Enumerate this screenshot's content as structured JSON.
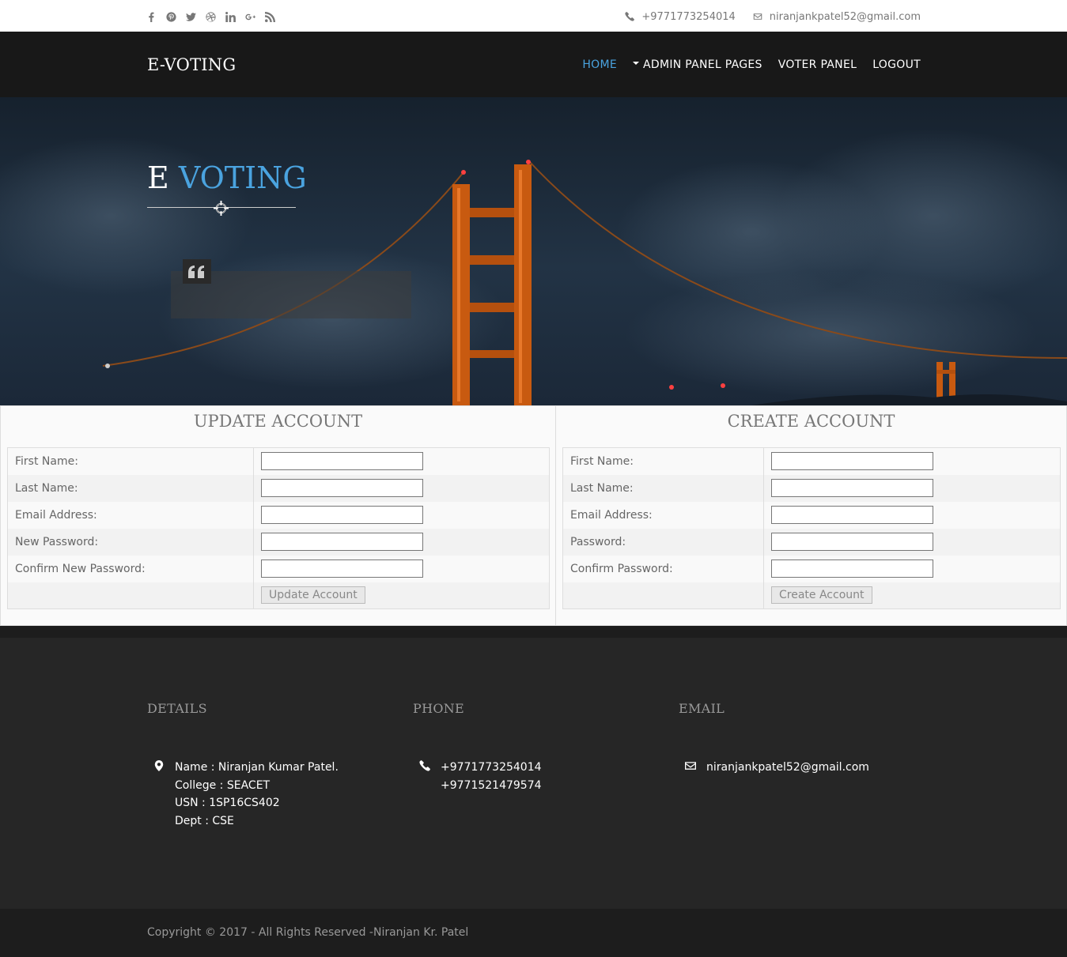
{
  "topbar": {
    "social_icons": [
      "facebook-icon",
      "pinterest-icon",
      "twitter-icon",
      "dribbble-icon",
      "linkedin-icon",
      "google-plus-icon",
      "rss-icon"
    ],
    "phone": "+9771773254014",
    "email": "niranjankpatel52@gmail.com"
  },
  "navbar": {
    "brand": "E-VOTING",
    "items": [
      {
        "label": "HOME",
        "active": true
      },
      {
        "label": "ADMIN PANEL PAGES",
        "dropdown": true
      },
      {
        "label": "VOTER PANEL"
      },
      {
        "label": "LOGOUT"
      }
    ],
    "active_color": "#4aa3df"
  },
  "hero": {
    "title_part1": "E",
    "title_part2": "VOTING"
  },
  "update_account": {
    "heading": "UPDATE ACCOUNT",
    "fields": [
      "First Name:",
      "Last Name:",
      "Email Address:",
      "New Password:",
      "Confirm New Password:"
    ],
    "button": "Update Account"
  },
  "create_account": {
    "heading": "CREATE ACCOUNT",
    "fields": [
      "First Name:",
      "Last Name:",
      "Email Address:",
      "Password:",
      "Confirm Password:"
    ],
    "button": "Create Account"
  },
  "footer": {
    "details": {
      "heading": "DETAILS",
      "lines": [
        "Name : Niranjan Kumar Patel.",
        "College : SEACET",
        "USN : 1SP16CS402",
        "Dept : CSE"
      ]
    },
    "phone": {
      "heading": "PHONE",
      "lines": [
        "+9771773254014",
        "+9771521479574"
      ]
    },
    "email": {
      "heading": "EMAIL",
      "lines": [
        "niranjankpatel52@gmail.com"
      ]
    },
    "copyright": "Copyright © 2017 - All Rights Reserved -Niranjan Kr. Patel"
  }
}
